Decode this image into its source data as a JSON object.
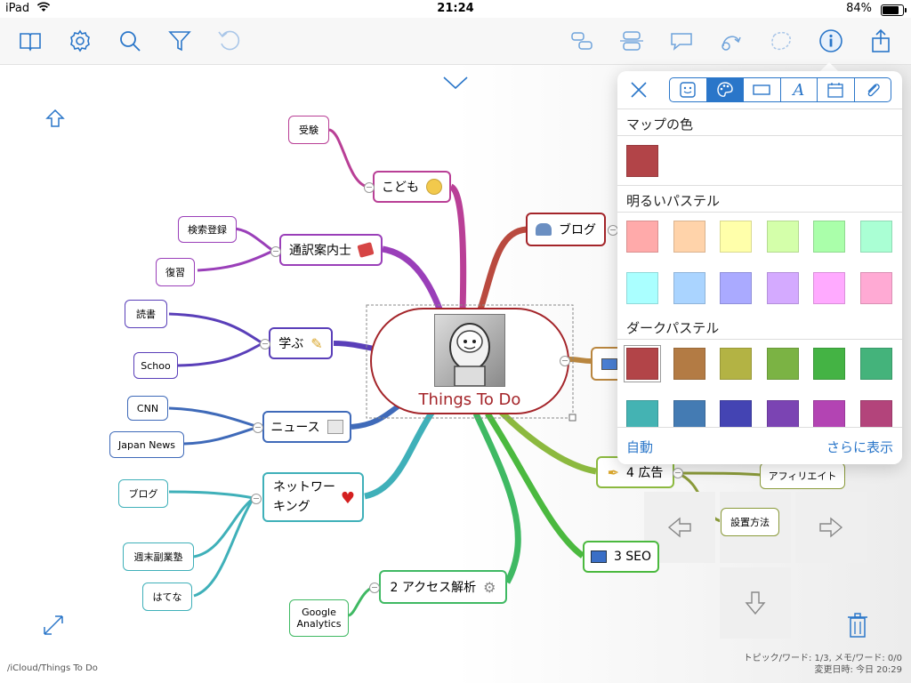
{
  "status": {
    "device": "iPad",
    "time": "21:24",
    "battery": "84%"
  },
  "colors": {
    "accent": "#2a76c9",
    "central_border": "#a4252a",
    "central_text": "#a4252a"
  },
  "central": {
    "label": "Things To Do"
  },
  "nodes": {
    "kodomo": "こども",
    "jyuken": "受験",
    "tsuyaku": "通訳案内士",
    "kensaku": "検索登録",
    "fukushu": "復習",
    "manabu": "学ぶ",
    "dokusho": "読書",
    "schoo": "Schoo",
    "news": "ニュース",
    "cnn": "CNN",
    "japan_news": "Japan News",
    "network_1": "ネットワー",
    "network_2": "キング",
    "blog_leaf": "ブログ",
    "shumatsu": "週末副業塾",
    "hatena": "はてな",
    "access": "2 アクセス解析",
    "google_1": "Google",
    "google_2": "Analytics",
    "blog": "ブログ",
    "ads": "4 広告",
    "affiliate": "アフィリエイト",
    "setchi": "設置方法",
    "seo": "3 SEO"
  },
  "panel": {
    "map_color": "マップの色",
    "bright_pastel": "明るいパステル",
    "dark_pastel": "ダークパステル",
    "auto": "自動",
    "more": "さらに表示",
    "map_color_value": "#b24448",
    "bright_row1": [
      "#ffaaaa",
      "#ffd3aa",
      "#ffffaa",
      "#d4ffaa",
      "#aaffaa",
      "#aaffd4"
    ],
    "bright_row2": [
      "#aaffff",
      "#aad4ff",
      "#aaaaff",
      "#d4aaff",
      "#ffaaff",
      "#ffaad4"
    ],
    "dark_row1": [
      "#b24448",
      "#b37b44",
      "#b3b344",
      "#7bb344",
      "#44b344",
      "#44b37b"
    ],
    "dark_row2": [
      "#44b3b3",
      "#447bb3",
      "#4444b3",
      "#7b44b3",
      "#b344b3",
      "#b3447b"
    ]
  },
  "footer": {
    "path": "/iCloud/Things To Do",
    "stats": "トピック/ワード: 1/3, メモ/ワード: 0/0",
    "modified": "変更日時: 今日 20:29"
  }
}
